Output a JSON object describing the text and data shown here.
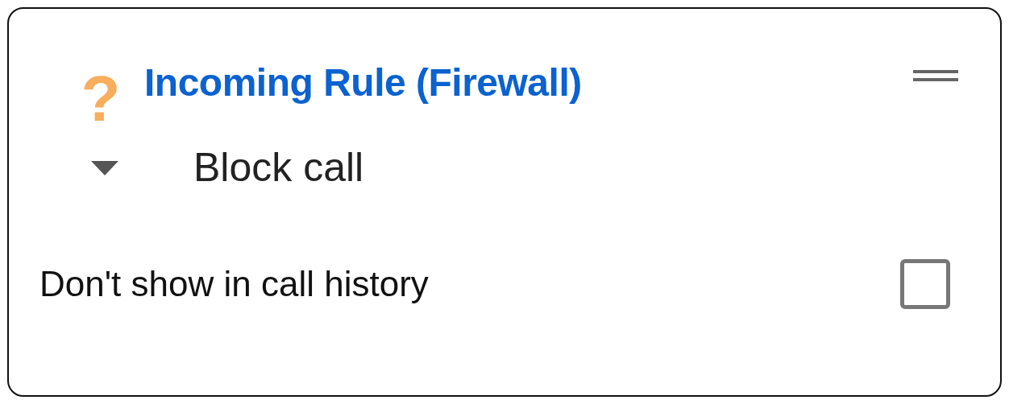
{
  "rule": {
    "icon": "?",
    "title": "Incoming Rule (Firewall)"
  },
  "action": {
    "value": "Block call",
    "expanded": false
  },
  "option": {
    "label": "Don't show in call history",
    "checked": false
  }
}
